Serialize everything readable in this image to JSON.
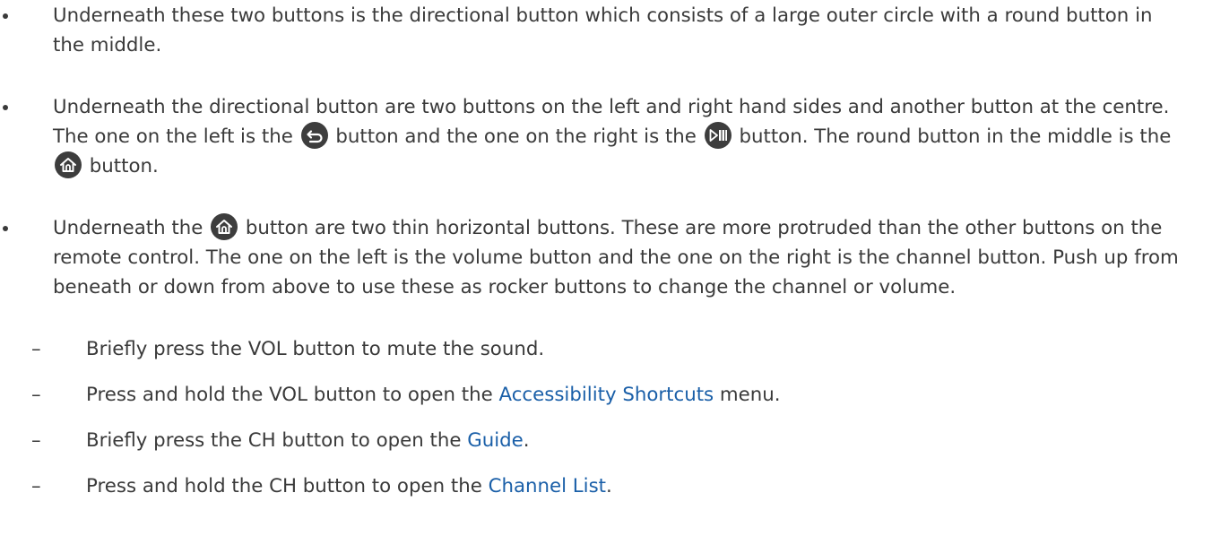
{
  "bullets": [
    {
      "text": "Underneath these two buttons is the directional button which consists of a large outer circle with a round button in the middle."
    },
    {
      "t1": "Underneath the directional button are two buttons on the left and right hand sides and another button at the centre. The one on the left is the",
      "t2": "button and the one on the right is the",
      "t3": "button. The round button in the middle is the",
      "t4": "button."
    },
    {
      "t1": "Underneath the",
      "t2": "button are two thin horizontal buttons. These are more protruded than the other buttons on the remote control. The one on the left is the volume button and the one on the right is the channel button. Push up from beneath or down from above to use these as rocker buttons to change the channel or volume."
    }
  ],
  "dash_mark": "–",
  "sub_items": [
    {
      "text": "Briefly press the VOL button to mute the sound."
    },
    {
      "pre": "Press and hold the VOL button to open the",
      "link": "Accessibility Shortcuts",
      "post": "menu."
    },
    {
      "pre": "Briefly press the CH button to open the",
      "link": "Guide",
      "post": "."
    },
    {
      "pre": "Press and hold the CH button to open the",
      "link": "Channel List",
      "post": "."
    }
  ],
  "icons": {
    "return": "return-icon",
    "play_pause": "play-pause-icon",
    "home": "home-icon"
  },
  "colors": {
    "text": "#3a3a3a",
    "link": "#1a5fa8",
    "icon_bg": "#3d3d3d"
  }
}
